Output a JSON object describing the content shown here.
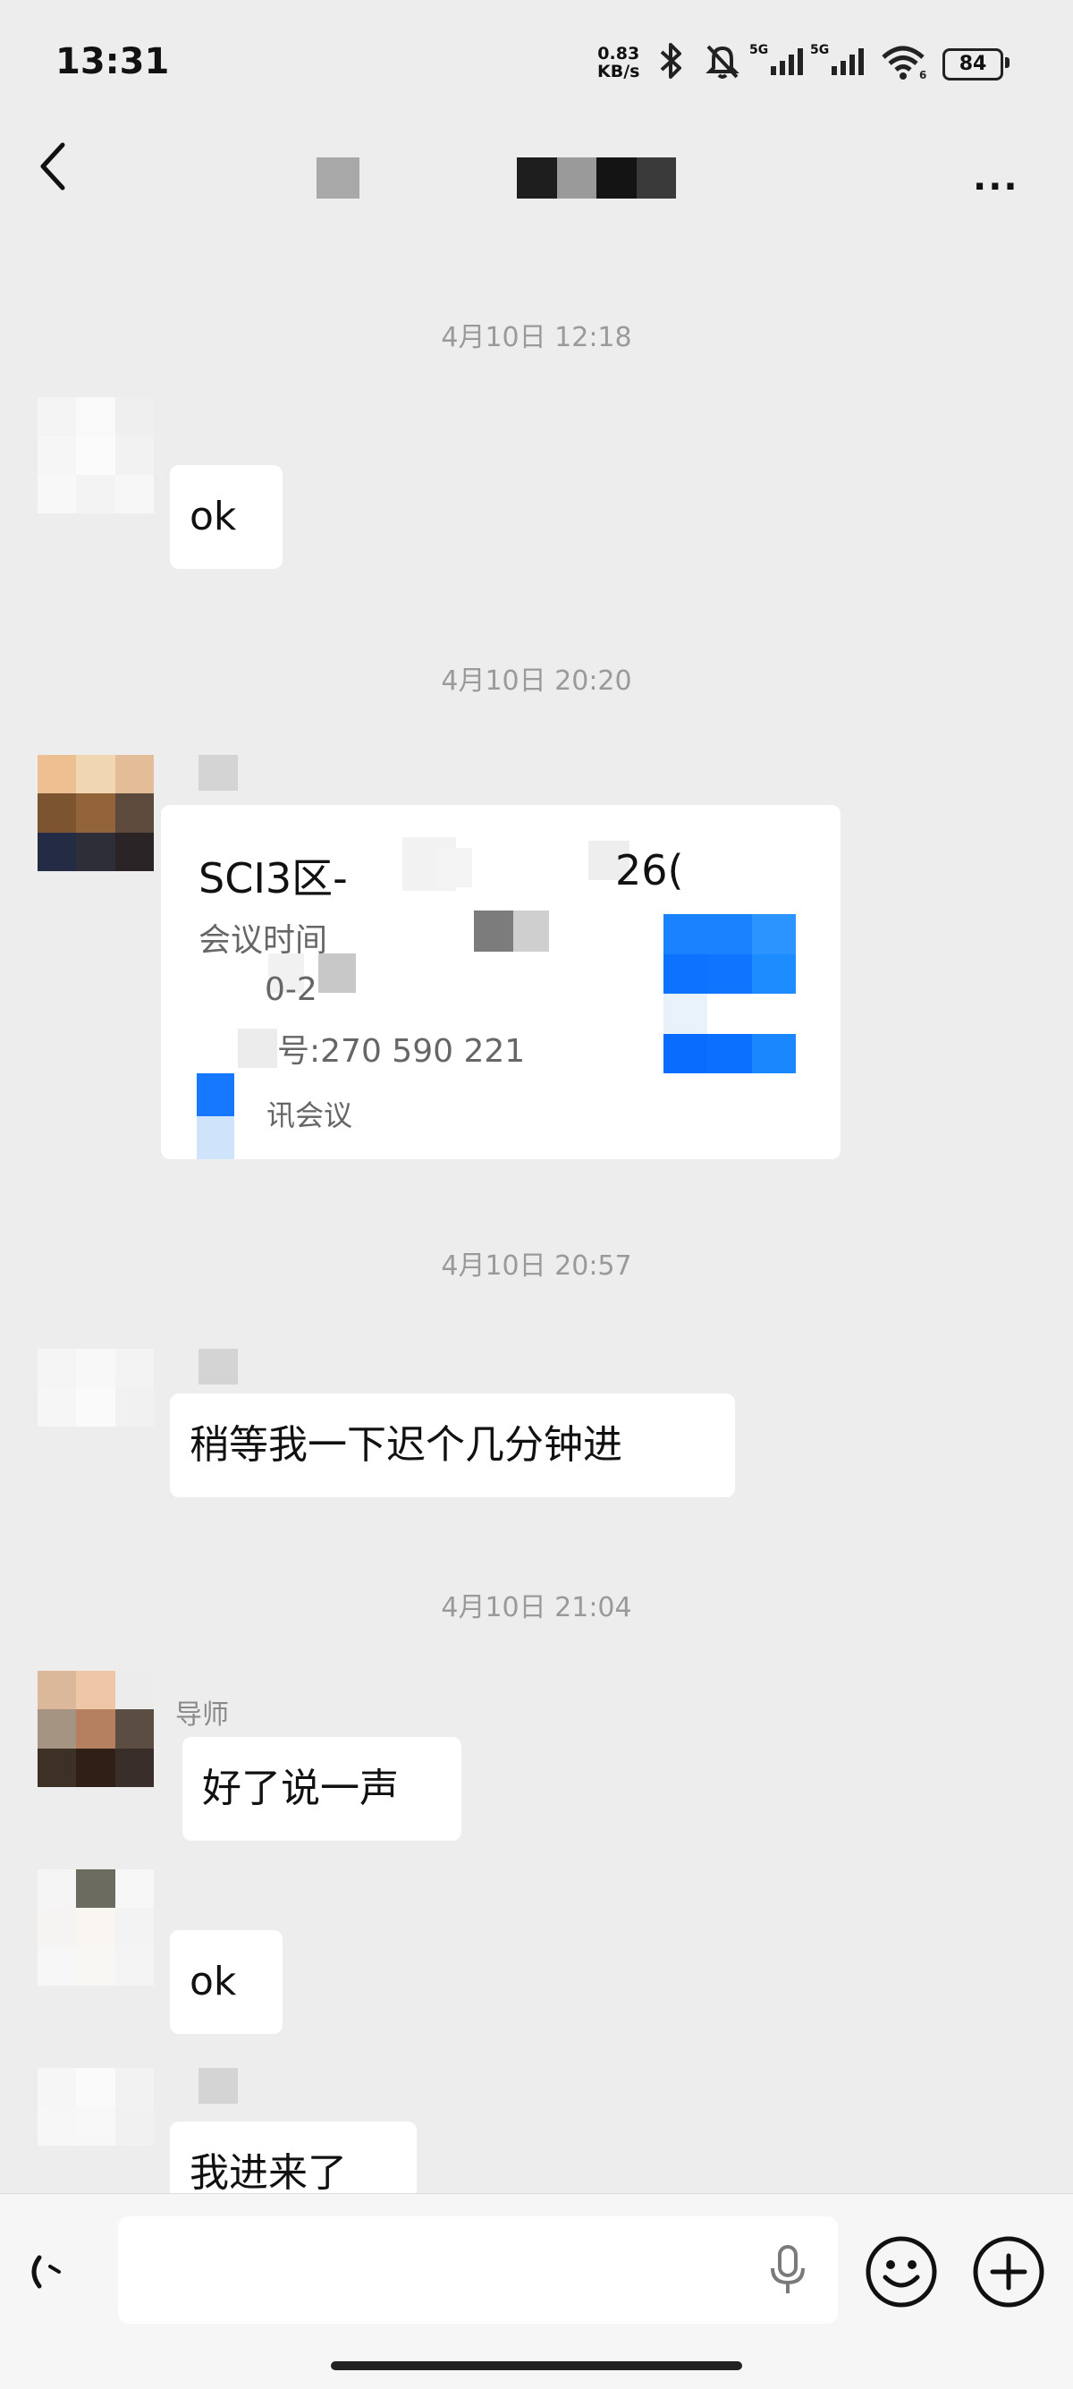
{
  "status_bar": {
    "time": "13:31",
    "net_speed_value": "0.83",
    "net_speed_unit": "KB/s",
    "sim1": "5G",
    "sim2": "5G",
    "battery": "84"
  },
  "chat": {
    "timestamps": [
      "4月10日 12:18",
      "4月10日 20:20",
      "4月10日 20:57",
      "4月10日 21:04"
    ],
    "messages": {
      "m1": "ok",
      "m3": "稍等我一下迟个几分钟进",
      "m4_sender": "导师",
      "m4": "好了说一声",
      "m5": "ok",
      "m6": "我进来了"
    },
    "meeting_card": {
      "title": "SCI3区-",
      "title_tail": "26(",
      "time_label": "会议时间",
      "time_value": "0-2",
      "id_line": "号:270 590 221",
      "app": "讯会议"
    }
  },
  "colors": {
    "background": "#ededed",
    "bubble": "#ffffff",
    "meeting_blue": "#1677ff"
  },
  "icons": [
    "back-icon",
    "more-icon",
    "voice-icon",
    "mic-icon",
    "emoji-icon",
    "plus-icon",
    "bluetooth-icon",
    "mute-icon",
    "wifi-icon",
    "battery-icon"
  ]
}
